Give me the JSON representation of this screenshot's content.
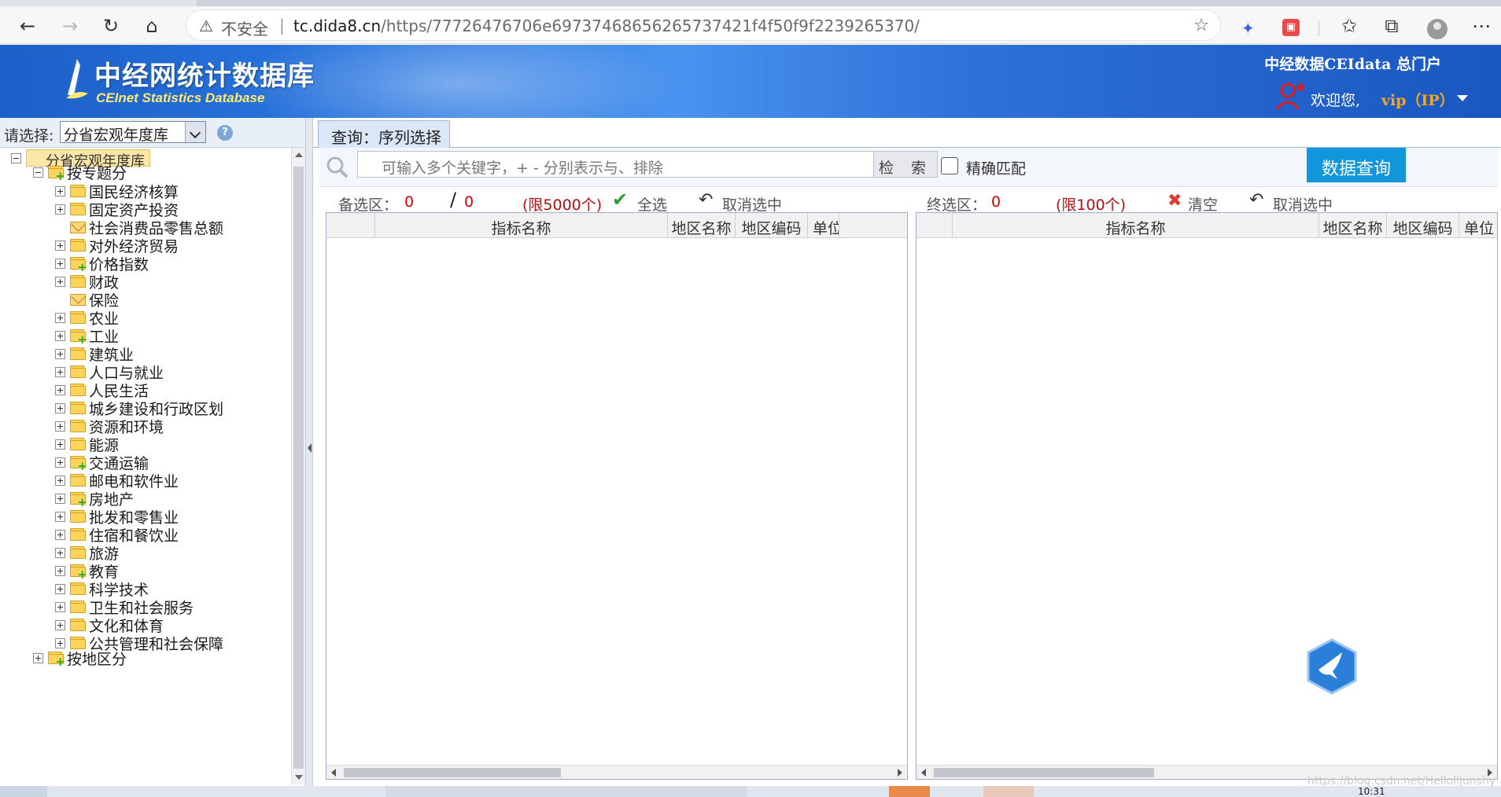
{
  "browser": {
    "warning_text": "不安全",
    "url_host": "tc.dida8.cn",
    "url_rest": "/https/77726476706e69737468656265737421f4f50f9f2239265370/"
  },
  "header": {
    "logo_cn": "中经网统计数据库",
    "logo_en": "CEInet Statistics Database",
    "portal_link": "中经数据CEIdata 总门户",
    "welcome": "欢迎您,",
    "user": "vip（IP）"
  },
  "left": {
    "select_label": "请选择:",
    "select_value": "分省宏观年度库",
    "help": "?",
    "tree": {
      "root": "分省宏观年度库",
      "by_topic": "按专题分",
      "items": [
        {
          "label": "国民经济核算",
          "icon": "folder-icon",
          "expand": "plus",
          "green": false
        },
        {
          "label": "固定资产投资",
          "icon": "folder-icon",
          "expand": "plus",
          "green": false
        },
        {
          "label": "社会消费品零售总额",
          "icon": "envelope-icon",
          "expand": "none",
          "green": false
        },
        {
          "label": "对外经济贸易",
          "icon": "folder-icon",
          "expand": "plus",
          "green": false
        },
        {
          "label": "价格指数",
          "icon": "folder-icon",
          "expand": "plus",
          "green": true
        },
        {
          "label": "财政",
          "icon": "folder-icon",
          "expand": "plus",
          "green": false
        },
        {
          "label": "保险",
          "icon": "envelope-icon",
          "expand": "none",
          "green": false
        },
        {
          "label": "农业",
          "icon": "folder-icon",
          "expand": "plus",
          "green": false
        },
        {
          "label": "工业",
          "icon": "folder-icon",
          "expand": "plus",
          "green": true
        },
        {
          "label": "建筑业",
          "icon": "folder-icon",
          "expand": "plus",
          "green": false
        },
        {
          "label": "人口与就业",
          "icon": "folder-icon",
          "expand": "plus",
          "green": false
        },
        {
          "label": "人民生活",
          "icon": "folder-icon",
          "expand": "plus",
          "green": false
        },
        {
          "label": "城乡建设和行政区划",
          "icon": "folder-icon",
          "expand": "plus",
          "green": false
        },
        {
          "label": "资源和环境",
          "icon": "folder-icon",
          "expand": "plus",
          "green": false
        },
        {
          "label": "能源",
          "icon": "folder-icon",
          "expand": "plus",
          "green": false
        },
        {
          "label": "交通运输",
          "icon": "folder-icon",
          "expand": "plus",
          "green": true
        },
        {
          "label": "邮电和软件业",
          "icon": "folder-icon",
          "expand": "plus",
          "green": false
        },
        {
          "label": "房地产",
          "icon": "folder-icon",
          "expand": "plus",
          "green": true
        },
        {
          "label": "批发和零售业",
          "icon": "folder-icon",
          "expand": "plus",
          "green": false
        },
        {
          "label": "住宿和餐饮业",
          "icon": "folder-icon",
          "expand": "plus",
          "green": false
        },
        {
          "label": "旅游",
          "icon": "folder-icon",
          "expand": "plus",
          "green": false
        },
        {
          "label": "教育",
          "icon": "folder-icon",
          "expand": "plus",
          "green": true
        },
        {
          "label": "科学技术",
          "icon": "folder-icon",
          "expand": "plus",
          "green": false
        },
        {
          "label": "卫生和社会服务",
          "icon": "folder-icon",
          "expand": "plus",
          "green": false
        },
        {
          "label": "文化和体育",
          "icon": "folder-icon",
          "expand": "plus",
          "green": false
        },
        {
          "label": "公共管理和社会保障",
          "icon": "folder-icon",
          "expand": "plus",
          "green": false
        }
      ],
      "by_region": "按地区分"
    }
  },
  "main": {
    "tab_label": "查询：序列选择",
    "search_placeholder": "可输入多个关键字，+ - 分别表示与、排除",
    "search_button": "检 索",
    "exact_match": "精确匹配",
    "query_button": "数据查询",
    "candidate": {
      "label": "备选区：",
      "count": "0",
      "slash": "/",
      "total": "0",
      "limit": "(限5000个)",
      "select_all": "全选",
      "deselect": "取消选中"
    },
    "final": {
      "label": "终选区：",
      "count": "0",
      "limit": "(限100个)",
      "clear": "清空",
      "deselect": "取消选中"
    },
    "columns_left": [
      "指标名称",
      "地区名称",
      "地区编码",
      "单位"
    ],
    "columns_right": [
      "指标名称",
      "地区名称",
      "地区编码",
      "单位"
    ]
  },
  "watermark": "https://blog.csdn.net/Hellolijunshy",
  "taskbar_clock": "10:31",
  "colors": {
    "header_blue": "#2a77e0",
    "query_button": "#1296db",
    "count_red": "#d40000",
    "vip_orange": "#f5a623"
  }
}
